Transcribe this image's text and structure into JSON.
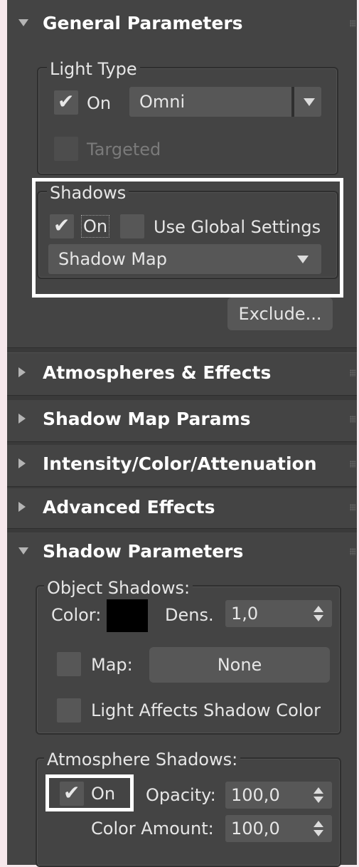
{
  "rollouts": {
    "general_parameters": {
      "title": "General Parameters",
      "expanded": true,
      "light_type": {
        "label": "Light Type",
        "on_checked": true,
        "on_label": "On",
        "type_value": "Omni",
        "targeted_label": "Targeted",
        "targeted_checked": false
      },
      "shadows": {
        "label": "Shadows",
        "on_checked": true,
        "on_label": "On",
        "use_global_checked": false,
        "use_global_label": "Use Global Settings",
        "type_value": "Shadow Map"
      },
      "exclude_label": "Exclude..."
    },
    "atmospheres_effects": {
      "title": "Atmospheres & Effects",
      "expanded": false
    },
    "shadow_map_params": {
      "title": "Shadow Map Params",
      "expanded": false
    },
    "intensity_color_attenuation": {
      "title": "Intensity/Color/Attenuation",
      "expanded": false
    },
    "advanced_effects": {
      "title": "Advanced Effects",
      "expanded": false
    },
    "shadow_parameters": {
      "title": "Shadow Parameters",
      "expanded": true,
      "object_shadows": {
        "label": "Object Shadows:",
        "color_label": "Color:",
        "color_value": "#000000",
        "dens_label": "Dens.",
        "dens_value": "1,0",
        "map_checked": false,
        "map_label": "Map:",
        "map_button": "None",
        "light_affects_checked": false,
        "light_affects_label": "Light Affects Shadow Color"
      },
      "atmosphere_shadows": {
        "label": "Atmosphere Shadows:",
        "on_checked": true,
        "on_label": "On",
        "opacity_label": "Opacity:",
        "opacity_value": "100,0",
        "color_amount_label": "Color Amount:",
        "color_amount_value": "100,0"
      }
    }
  },
  "icons": {
    "expanded": "triangle-down-icon",
    "collapsed": "triangle-right-icon",
    "check": "checkmark-icon",
    "grip": "drag-grip-icon"
  },
  "colors": {
    "panel_bg": "#444444",
    "control_bg": "#575757",
    "highlight": "#ffffff",
    "page_bg": "#f6e8ec"
  }
}
